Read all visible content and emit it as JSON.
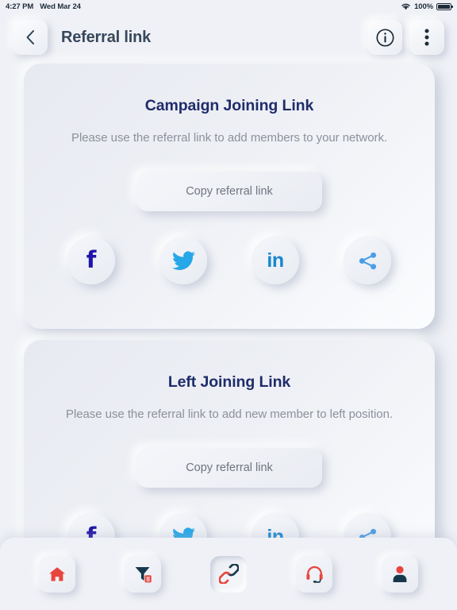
{
  "status_bar": {
    "time": "4:27 PM",
    "date": "Wed Mar 24",
    "battery_percent": "100%",
    "wifi_icon": "wifi-icon",
    "battery_icon": "battery-icon"
  },
  "header": {
    "back_icon": "chevron-left-icon",
    "title": "Referral link",
    "info_icon": "info-circle-icon",
    "menu_icon": "more-vertical-icon"
  },
  "cards": [
    {
      "title": "Campaign Joining Link",
      "subtitle": "Please use the referral link to add members to your network.",
      "copy_label": "Copy referral link",
      "socials": [
        {
          "name": "facebook-icon",
          "label": "f",
          "color": "#2015a8"
        },
        {
          "name": "twitter-icon",
          "label": "",
          "color": "#26a7e8"
        },
        {
          "name": "linkedin-icon",
          "label": "in",
          "color": "#1886d0"
        },
        {
          "name": "share-icon",
          "label": "",
          "color": "#4a9ee8"
        }
      ]
    },
    {
      "title": "Left Joining Link",
      "subtitle": "Please use the referral link to add new member to left position.",
      "copy_label": "Copy referral link",
      "socials": [
        {
          "name": "facebook-icon",
          "label": "f",
          "color": "#2015a8"
        },
        {
          "name": "twitter-icon",
          "label": "",
          "color": "#26a7e8"
        },
        {
          "name": "linkedin-icon",
          "label": "in",
          "color": "#1886d0"
        },
        {
          "name": "share-icon",
          "label": "",
          "color": "#4a9ee8"
        }
      ]
    }
  ],
  "bottom_nav": [
    {
      "name": "nav-home",
      "icon": "home-icon",
      "active": false
    },
    {
      "name": "nav-funnel",
      "icon": "funnel-report-icon",
      "active": false
    },
    {
      "name": "nav-referral-link",
      "icon": "link-chain-icon",
      "active": true
    },
    {
      "name": "nav-support",
      "icon": "headset-icon",
      "active": false
    },
    {
      "name": "nav-profile",
      "icon": "user-icon",
      "active": false
    }
  ],
  "colors": {
    "page_bg": "#eff1f6",
    "title_navy": "#1f2c6b",
    "header_text": "#37475b",
    "body_gray": "#8d919c",
    "accent_red": "#e8453f",
    "dark_navy": "#163a4e"
  }
}
